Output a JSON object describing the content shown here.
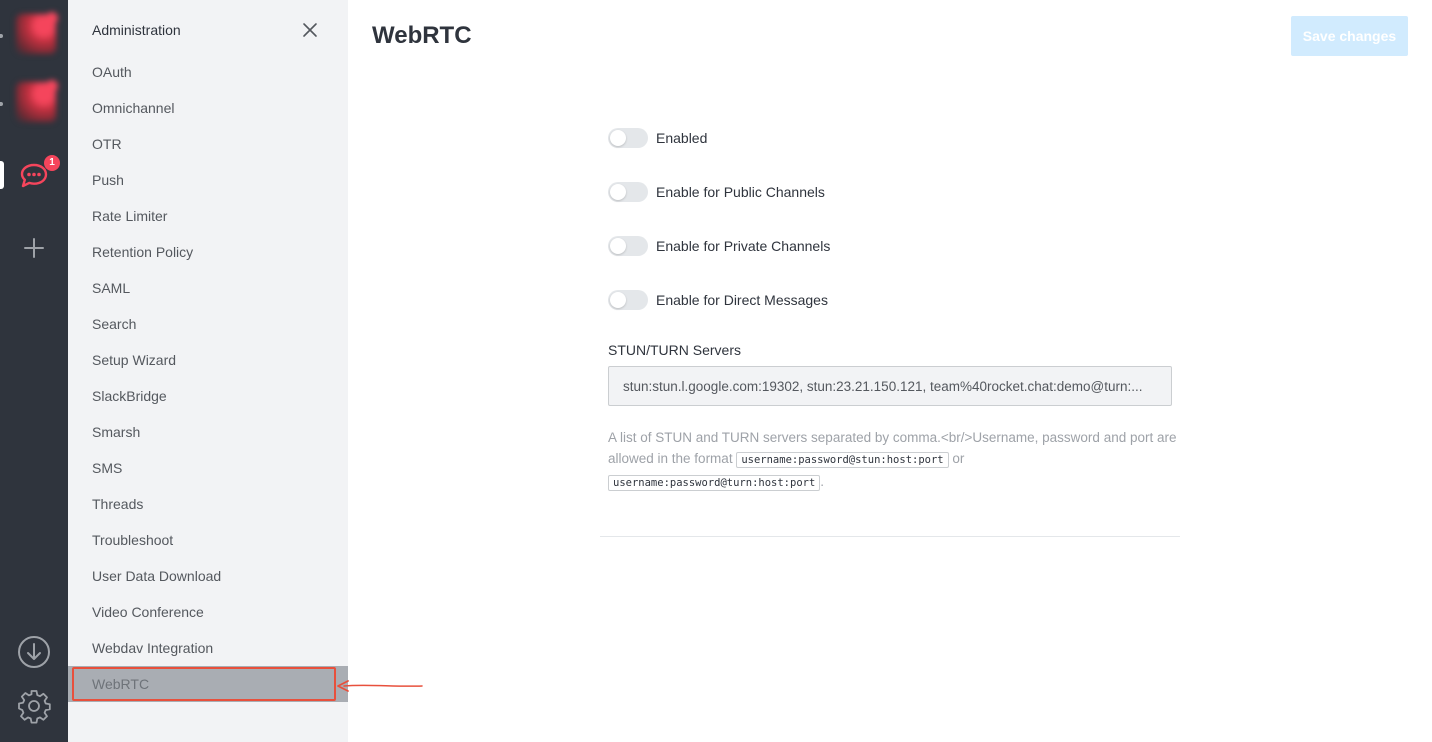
{
  "rail": {
    "notification_count": "1",
    "icons": [
      "rocket-chat-server-icon",
      "add-server-icon",
      "download-icon",
      "settings-icon"
    ]
  },
  "sidebar": {
    "title": "Administration",
    "items": [
      {
        "label": "OAuth"
      },
      {
        "label": "Omnichannel"
      },
      {
        "label": "OTR"
      },
      {
        "label": "Push"
      },
      {
        "label": "Rate Limiter"
      },
      {
        "label": "Retention Policy"
      },
      {
        "label": "SAML"
      },
      {
        "label": "Search"
      },
      {
        "label": "Setup Wizard"
      },
      {
        "label": "SlackBridge"
      },
      {
        "label": "Smarsh"
      },
      {
        "label": "SMS"
      },
      {
        "label": "Threads"
      },
      {
        "label": "Troubleshoot"
      },
      {
        "label": "User Data Download"
      },
      {
        "label": "Video Conference"
      },
      {
        "label": "Webdav Integration"
      },
      {
        "label": "WebRTC",
        "active": true
      }
    ]
  },
  "header": {
    "title": "WebRTC",
    "save_label": "Save changes"
  },
  "settings": {
    "toggles": [
      {
        "label": "Enabled",
        "on": false
      },
      {
        "label": "Enable for Public Channels",
        "on": false
      },
      {
        "label": "Enable for Private Channels",
        "on": false
      },
      {
        "label": "Enable for Direct Messages",
        "on": false
      }
    ],
    "servers": {
      "label": "STUN/TURN Servers",
      "value": "stun:stun.l.google.com:19302, stun:23.21.150.121, team%40rocket.chat:demo@turn:...",
      "hint_before": "A list of STUN and TURN servers separated by comma.<br/>Username, password and port are allowed in the format ",
      "code1": "username:password@stun:host:port",
      "hint_or": " or ",
      "code2": "username:password@turn:host:port",
      "hint_end": "."
    }
  },
  "colors": {
    "rail_bg": "#2f343d",
    "sidebar_bg": "#f2f3f5",
    "brand_red": "#f5455c",
    "annotation": "#e8503c",
    "save_disabled": "#d1ebfe"
  }
}
